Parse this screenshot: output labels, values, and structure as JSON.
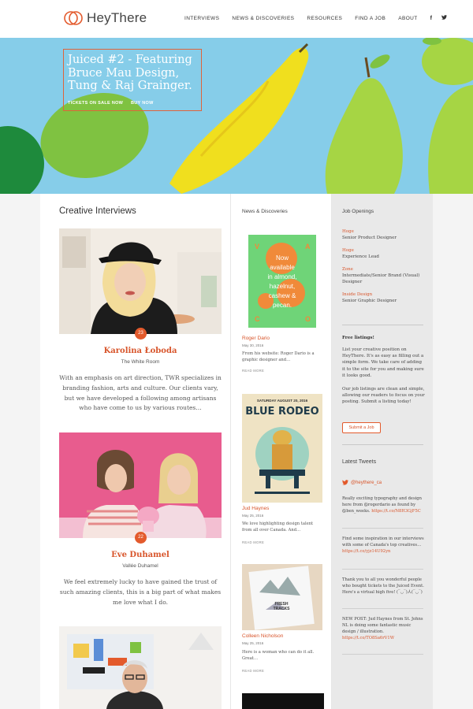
{
  "brand": {
    "name": "HeyThere",
    "accent": "#e35a2c"
  },
  "nav": {
    "items": [
      "INTERVIEWS",
      "NEWS & DISCOVERIES",
      "RESOURCES",
      "FIND A JOB",
      "ABOUT"
    ],
    "social": [
      "f",
      "𝕏"
    ]
  },
  "hero": {
    "title": "Juiced #2 - Featuring Bruce Mau Design, Tung & Raj Grainger.",
    "links": [
      "TICKETS ON SALE NOW",
      "BUY NOW"
    ]
  },
  "interviews": {
    "title": "Creative Interviews",
    "items": [
      {
        "number": "23",
        "name": "Karolina Łoboda",
        "company": "The White Room",
        "text": "With an emphasis on art direction, TWR specializes in branding fashion, arts and culture. Our clients vary, but we have developed a following among artisans who have come to us by various routes…"
      },
      {
        "number": "22",
        "name": "Eve Duhamel",
        "company": "Vallée Duhamel",
        "text": "We feel extremely lucky to have gained the trust of such amazing clients, this is a big part of what makes me love what I do."
      }
    ]
  },
  "news": {
    "title": "News & Discoveries",
    "items": [
      {
        "title": "Roger Dario",
        "date": "May 30, 2016",
        "text": "From his website: Roger Dario is a graphic designer and…",
        "more": "READ MORE",
        "poster": {
          "text": "Now available in almond, hazelnut, cashew & pecan.",
          "letters": [
            "V",
            "A",
            "C",
            "O"
          ]
        }
      },
      {
        "title": "Jud Haynes",
        "date": "May 25, 2016",
        "text": "We love highlighting design talent from all over Canada. And…",
        "more": "READ MORE",
        "poster": {
          "top": "SATURDAY AUGUST 20, 2016",
          "headline": "BLUE RODEO"
        }
      },
      {
        "title": "Colleen Nicholson",
        "date": "May 25, 2016",
        "text": "Here is a woman who can do it all. Great…",
        "more": "READ MORE",
        "poster": {
          "text": "FRESH TRACKS"
        }
      }
    ]
  },
  "jobs": {
    "title": "Job Openings",
    "items": [
      {
        "company": "Hoge",
        "title": "Senior Product Designer"
      },
      {
        "company": "Hoge",
        "title": "Experience Lead"
      },
      {
        "company": "Zone",
        "title": "Intermediate/Senior Brand (Visual) Designer"
      },
      {
        "company": "Inside Design",
        "title": "Senior Graphic Designer"
      }
    ],
    "free_heading": "Free listings!",
    "free_text_1": "List your creative position on HeyThere. It's as easy as filling out a simple form. We take care of adding it to the site for you and making sure it looks good.",
    "free_text_2": "Our job listings are clean and simple, allowing our readers to focus on your posting. Submit a listing today!",
    "submit_label": "Submit a Job"
  },
  "tweets": {
    "title": "Latest Tweets",
    "handle": "@heythere_ca",
    "items": [
      {
        "text": "Really exciting typography and design here from @rogerdario as found by @ben_weeks.",
        "link": "https://t.co/N8H3GjF5C"
      },
      {
        "text": "Find some inspiration in our interviews with some of Canada's top creatives…",
        "link": "https://t.co/yjz14U92yn"
      },
      {
        "text": "Thank you to all you wonderful people who bought tickets to the Juiced Event. Here's a virtual high five! (‾◡‾)人(‾◡‾)",
        "link": ""
      },
      {
        "text": "NEW POST: Jud Haynes from St. Johns NL is doing some fantastic music design / illustration.",
        "link": "https://t.co/TO8Sa6rV1W"
      }
    ]
  }
}
